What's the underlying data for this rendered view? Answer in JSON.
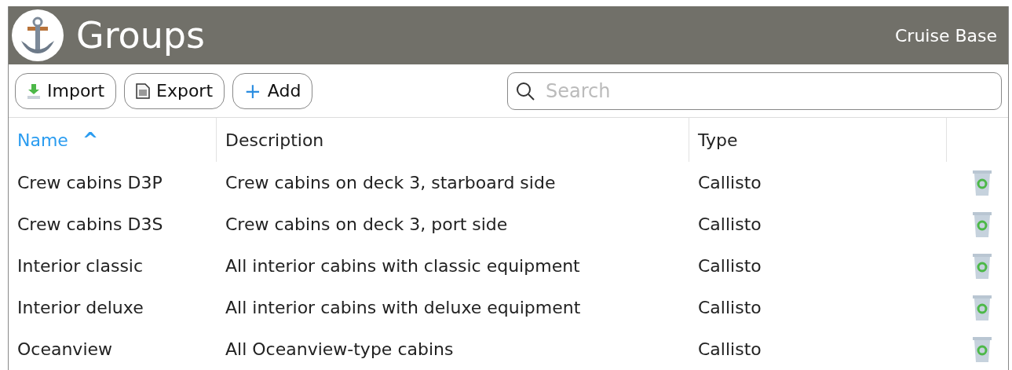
{
  "header": {
    "title": "Groups",
    "subtitle": "Cruise Base"
  },
  "toolbar": {
    "buttons": [
      {
        "kind": "import",
        "label": "Import"
      },
      {
        "kind": "export",
        "label": "Export"
      },
      {
        "kind": "add",
        "label": "+",
        "label2": "Add"
      }
    ],
    "search": {
      "placeholder": "Search"
    }
  },
  "table": {
    "columns": [
      {
        "label": "Name",
        "sorted": true,
        "sort_icon": "^"
      },
      {
        "label": "Description",
        "sorted": false
      },
      {
        "label": "Type",
        "sorted": false
      }
    ],
    "rows": [
      {
        "name": "Crew cabins D3P",
        "description": "Crew cabins on deck 3, starboard side",
        "type": "Callisto"
      },
      {
        "name": "Crew cabins D3S",
        "description": "Crew cabins on deck 3, port side",
        "type": "Callisto"
      },
      {
        "name": "Interior classic",
        "description": "All interior cabins with classic equipment",
        "type": "Callisto"
      },
      {
        "name": "Interior deluxe",
        "description": "All interior cabins with deluxe equipment",
        "type": "Callisto"
      },
      {
        "name": "Oceanview",
        "description": "All Oceanview-type cabins",
        "type": "Callisto"
      }
    ]
  }
}
